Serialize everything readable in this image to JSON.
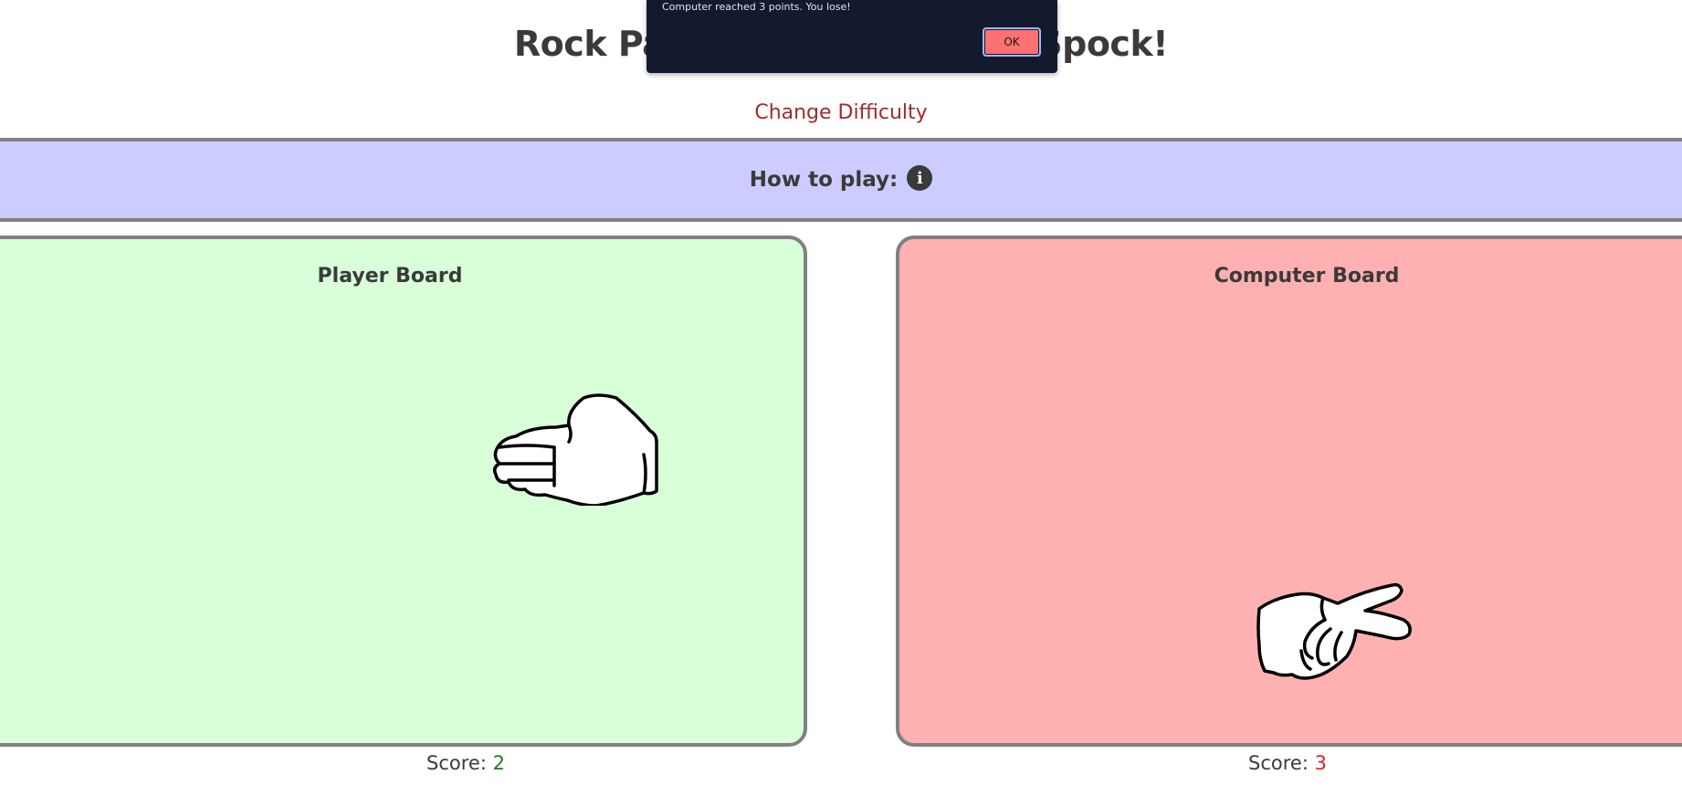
{
  "header": {
    "title": "Rock Paper Scissors Lizard Spock!",
    "change_difficulty": "Change Difficulty"
  },
  "how_to_play": {
    "label": "How to play:",
    "icon": "info-icon"
  },
  "boards": {
    "player": {
      "title": "Player Board",
      "choice_icon": "hand-paper-icon",
      "score_label": "Score:",
      "score": "2"
    },
    "computer": {
      "title": "Computer Board",
      "choice_icon": "hand-scissors-icon",
      "score_label": "Score:",
      "score": "3"
    }
  },
  "dialog": {
    "message": "Computer reached 3 points. You lose!",
    "ok_label": "OK"
  },
  "colors": {
    "player_board": "#d8ffd8",
    "computer_board": "#ffb0b0",
    "how_to_play_bar": "#ccccff",
    "difficulty_link": "#a02c2c",
    "player_score": "#1e7a1e",
    "computer_score": "#dd2222",
    "dialog_bg": "#141a2e",
    "ok_button": "#ff7070"
  }
}
